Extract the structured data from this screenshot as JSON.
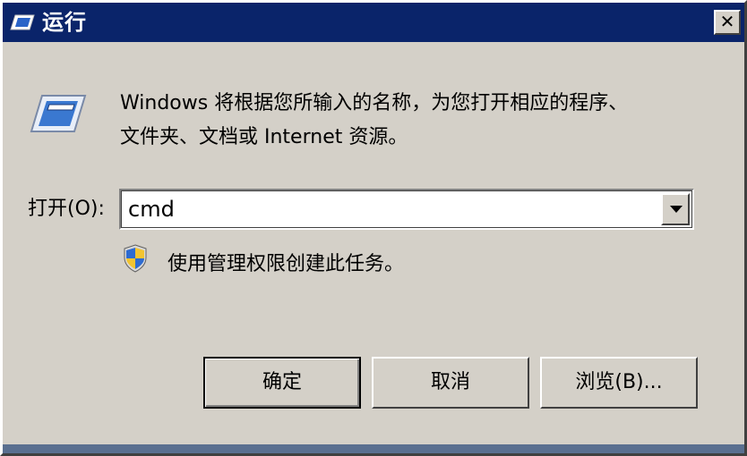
{
  "window": {
    "title": "运行",
    "close_label": "✕"
  },
  "dialog": {
    "description_line1": "Windows 将根据您所输入的名称，为您打开相应的程序、",
    "description_line2": "文件夹、文档或 Internet 资源。",
    "open_label": "打开(O):",
    "input_value": "cmd",
    "admin_note": "使用管理权限创建此任务。"
  },
  "buttons": {
    "ok": "确定",
    "cancel": "取消",
    "browse": "浏览(B)..."
  },
  "icons": {
    "title": "run-app-icon",
    "run": "run-app-icon",
    "shield": "uac-shield-icon",
    "dropdown": "chevron-down-icon"
  },
  "colors": {
    "titlebar": "#0a246a",
    "dialog_bg": "#d4d0c8"
  }
}
